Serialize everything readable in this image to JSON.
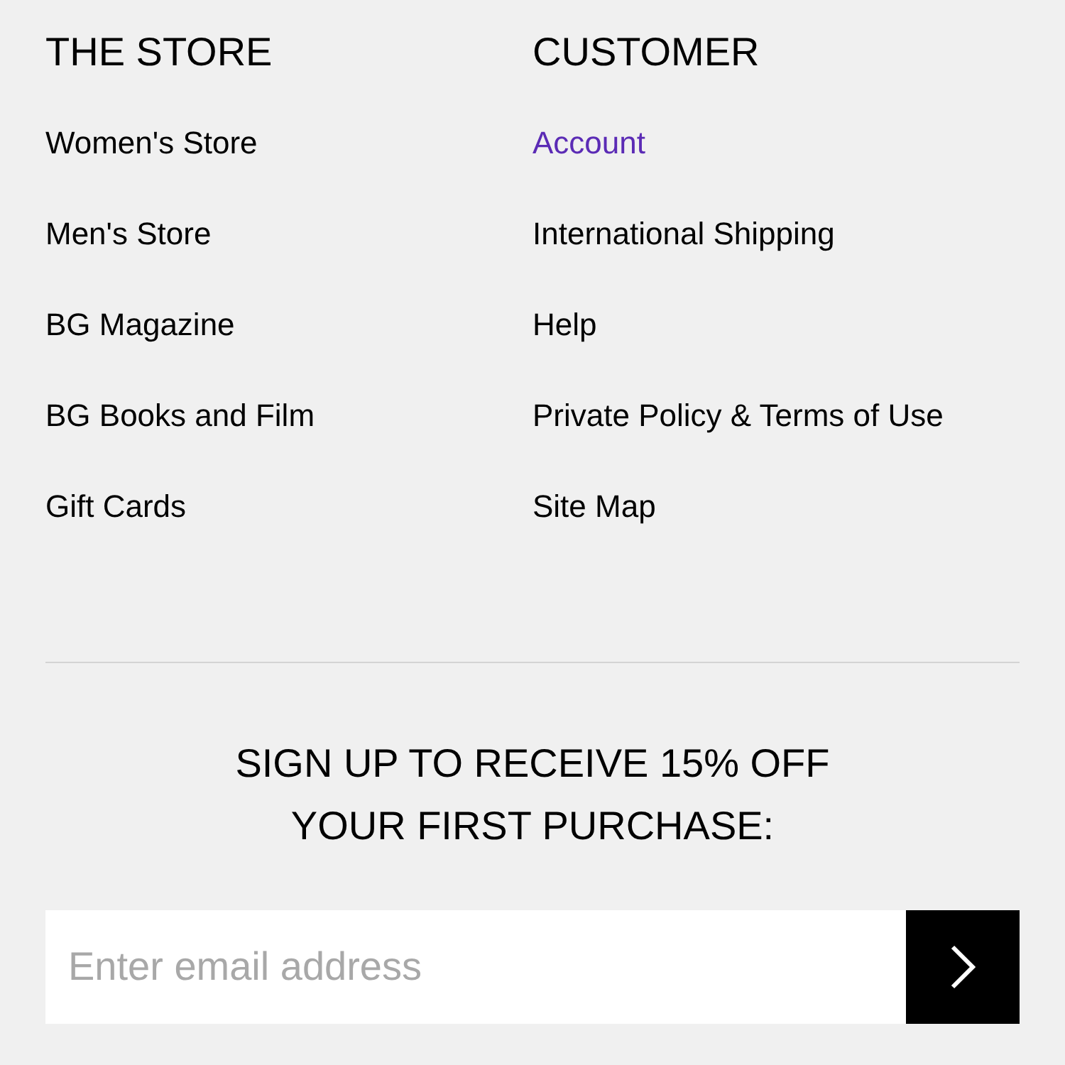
{
  "columns": [
    {
      "heading": "THE STORE",
      "links": [
        {
          "label": "Women's Store",
          "highlighted": false
        },
        {
          "label": "Men's Store",
          "highlighted": false
        },
        {
          "label": "BG Magazine",
          "highlighted": false
        },
        {
          "label": "BG Books and Film",
          "highlighted": false
        },
        {
          "label": "Gift Cards",
          "highlighted": false
        }
      ]
    },
    {
      "heading": "CUSTOMER",
      "links": [
        {
          "label": "Account",
          "highlighted": true
        },
        {
          "label": "International Shipping",
          "highlighted": false
        },
        {
          "label": "Help",
          "highlighted": false
        },
        {
          "label": "Private Policy & Terms of Use",
          "highlighted": false
        },
        {
          "label": "Site Map",
          "highlighted": false
        }
      ]
    }
  ],
  "signup": {
    "lines": [
      "SIGN UP TO RECEIVE 15% OFF",
      "YOUR FIRST PURCHASE:"
    ],
    "email": {
      "placeholder": "Enter email address"
    }
  }
}
